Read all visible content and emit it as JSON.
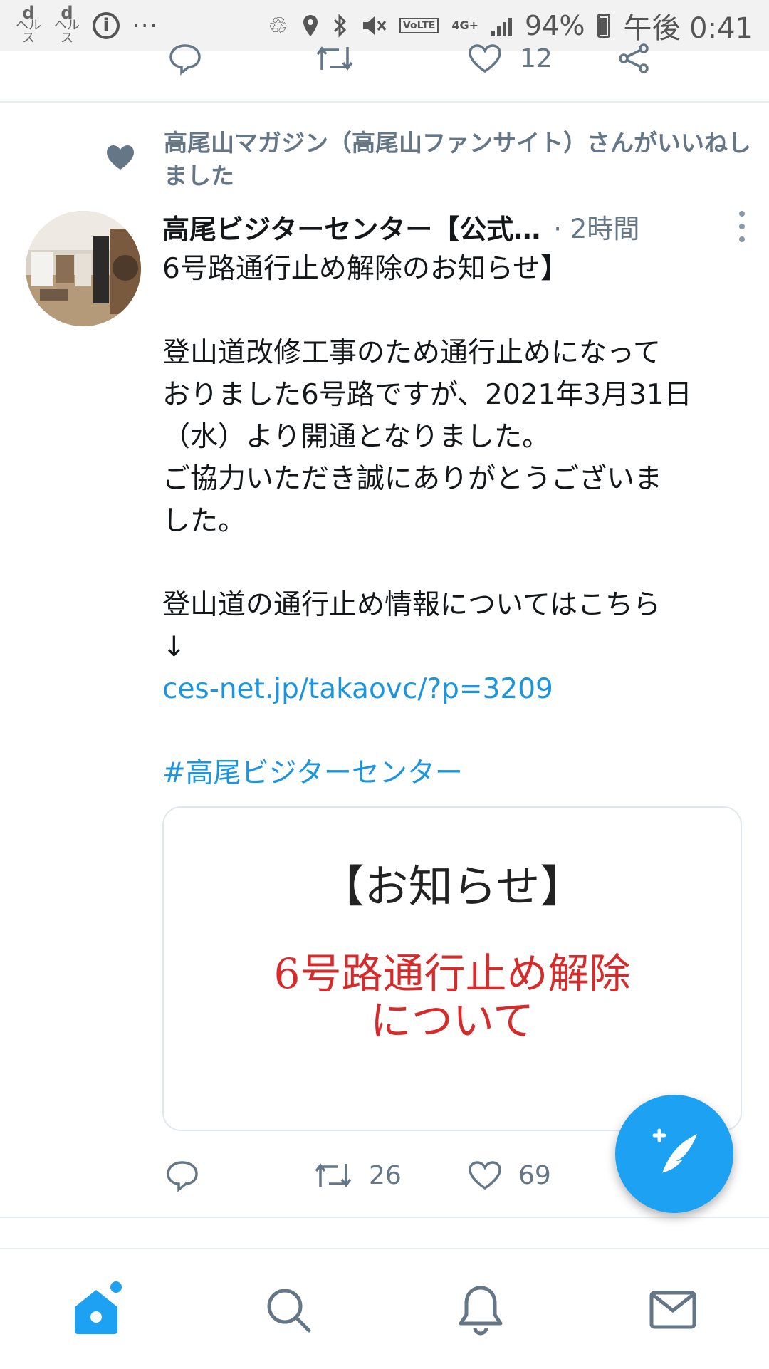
{
  "status_bar": {
    "app1": "d",
    "app1_sub": "ヘルス",
    "app2": "d",
    "app2_sub": "ヘルス",
    "info": "i",
    "more": "···",
    "network": "4G+",
    "volte": "VoLTE",
    "battery": "94%",
    "time": "午後 0:41"
  },
  "prev_tweet": {
    "likes": "12"
  },
  "liked_banner": {
    "text": "高尾山マガジン（高尾山ファンサイト）さんがいいねしました"
  },
  "tweet": {
    "author": "高尾ビジターセンター【公式…",
    "time": "· 2時間",
    "line1": "6号路通行止め解除のお知らせ】",
    "para1": [
      "登山道改修工事のため通行止めになって",
      "おりました6号路ですが、2021年3月31日",
      "（水）より開通となりました。",
      "ご協力いただき誠にありがとうございま",
      "した。"
    ],
    "para2": [
      "登山道の通行止め情報についてはこちら",
      "↓"
    ],
    "link": "ces-net.jp/takaovc/?p=3209",
    "hashtag": "#高尾ビジターセンター",
    "card": {
      "title": "【お知らせ】",
      "red_line1": "6号路通行止め解除",
      "red_line2": "について"
    },
    "retweets": "26",
    "likes": "69"
  },
  "colors": {
    "accent": "#1da1f2",
    "link": "#1b95e0",
    "muted": "#657786",
    "card_red": "#d62b2b"
  },
  "icons": {
    "status": [
      "d-health-icon",
      "info-icon",
      "recycle-icon",
      "location-icon",
      "bluetooth-icon",
      "mute-icon",
      "signal-icon",
      "battery-icon"
    ],
    "actions": [
      "reply-icon",
      "retweet-icon",
      "like-icon",
      "share-icon"
    ],
    "nav": [
      "home-icon",
      "search-icon",
      "notifications-icon",
      "messages-icon"
    ],
    "fab": "compose-tweet-icon"
  }
}
